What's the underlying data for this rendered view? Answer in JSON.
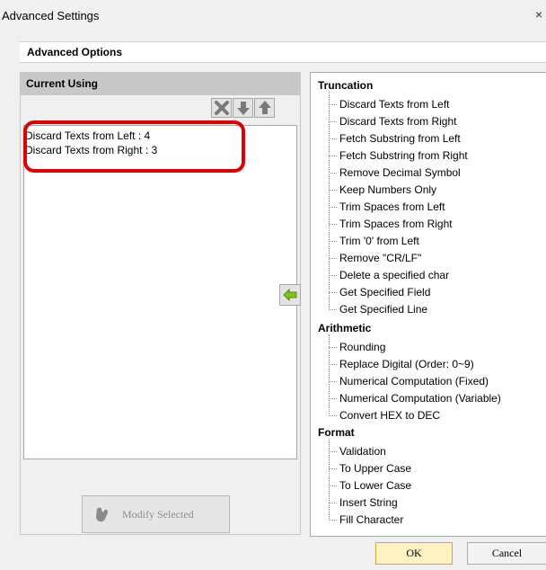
{
  "window": {
    "title": "Advanced Settings",
    "close_glyph": "×"
  },
  "advanced_options": {
    "heading": "Advanced Options"
  },
  "current_using": {
    "heading": "Current Using",
    "toolbar_icons": [
      "delete-icon",
      "move-down-icon",
      "move-up-icon"
    ],
    "items": [
      "Discard Texts from Left : 4",
      "Discard Texts from Right : 3"
    ],
    "modify_button": "Modify Selected"
  },
  "add_arrow_icon": "arrow-left-icon",
  "tree": {
    "categories": [
      {
        "label": "Truncation",
        "items": [
          "Discard Texts from Left",
          "Discard Texts from Right",
          "Fetch Substring from Left",
          "Fetch Substring from Right",
          "Remove Decimal Symbol",
          "Keep Numbers Only",
          "Trim Spaces from Left",
          "Trim Spaces from Right",
          "Trim '0' from Left",
          "Remove \"CR/LF\"",
          "Delete a specified char",
          "Get Specified Field",
          "Get Specified Line"
        ]
      },
      {
        "label": "Arithmetic",
        "items": [
          "Rounding",
          "Replace Digital (Order: 0~9)",
          "Numerical Computation (Fixed)",
          "Numerical Computation (Variable)",
          "Convert HEX to DEC"
        ]
      },
      {
        "label": "Format",
        "items": [
          "Validation",
          "To Upper Case",
          "To Lower Case",
          "Insert String",
          "Fill Character"
        ]
      }
    ]
  },
  "buttons": {
    "ok": "OK",
    "cancel": "Cancel"
  },
  "colors": {
    "highlight": "#e00000",
    "arrow": "#7fc31c",
    "ok_bg": "#fff3c4"
  }
}
